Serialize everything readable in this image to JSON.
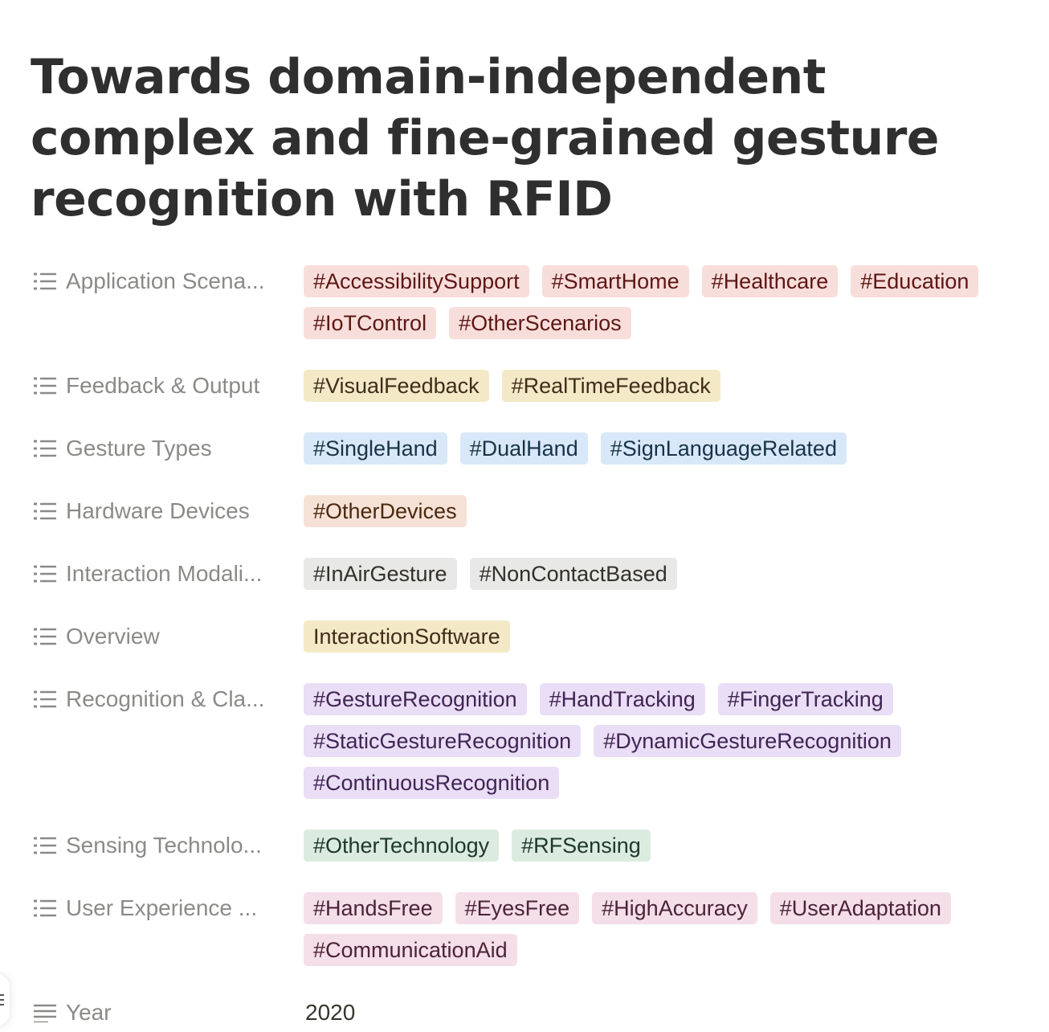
{
  "page": {
    "title": "Towards domain-independent complex and fine-grained gesture recognition with RFID"
  },
  "properties": [
    {
      "label": "Application Scena...",
      "icon": "list-icon",
      "tags": [
        {
          "text": "#AccessibilitySupport",
          "color": "red"
        },
        {
          "text": "#SmartHome",
          "color": "red"
        },
        {
          "text": "#Healthcare",
          "color": "red"
        },
        {
          "text": "#Education",
          "color": "red"
        },
        {
          "text": "#IoTControl",
          "color": "red"
        },
        {
          "text": "#OtherScenarios",
          "color": "red"
        }
      ]
    },
    {
      "label": "Feedback & Output",
      "icon": "list-icon",
      "tags": [
        {
          "text": "#VisualFeedback",
          "color": "yellow"
        },
        {
          "text": "#RealTimeFeedback",
          "color": "yellow"
        }
      ]
    },
    {
      "label": "Gesture Types",
      "icon": "list-icon",
      "tags": [
        {
          "text": "#SingleHand",
          "color": "blue"
        },
        {
          "text": "#DualHand",
          "color": "blue"
        },
        {
          "text": "#SignLanguageRelated",
          "color": "blue"
        }
      ]
    },
    {
      "label": "Hardware Devices",
      "icon": "list-icon",
      "tags": [
        {
          "text": "#OtherDevices",
          "color": "orange"
        }
      ]
    },
    {
      "label": "Interaction Modali...",
      "icon": "list-icon",
      "tags": [
        {
          "text": "#InAirGesture",
          "color": "gray"
        },
        {
          "text": "#NonContactBased",
          "color": "gray"
        }
      ]
    },
    {
      "label": "Overview",
      "icon": "list-icon",
      "tags": [
        {
          "text": "InteractionSoftware",
          "color": "yellow"
        }
      ]
    },
    {
      "label": "Recognition & Cla...",
      "icon": "list-icon",
      "tags": [
        {
          "text": "#GestureRecognition",
          "color": "purple"
        },
        {
          "text": "#HandTracking",
          "color": "purple"
        },
        {
          "text": "#FingerTracking",
          "color": "purple"
        },
        {
          "text": "#StaticGestureRecognition",
          "color": "purple"
        },
        {
          "text": "#DynamicGestureRecognition",
          "color": "purple"
        },
        {
          "text": "#ContinuousRecognition",
          "color": "purple"
        }
      ]
    },
    {
      "label": "Sensing Technolo...",
      "icon": "list-icon",
      "tags": [
        {
          "text": "#OtherTechnology",
          "color": "green"
        },
        {
          "text": "#RFSensing",
          "color": "green"
        }
      ]
    },
    {
      "label": "User Experience ...",
      "icon": "list-icon",
      "tags": [
        {
          "text": "#HandsFree",
          "color": "pink"
        },
        {
          "text": "#EyesFree",
          "color": "pink"
        },
        {
          "text": "#HighAccuracy",
          "color": "pink"
        },
        {
          "text": "#UserAdaptation",
          "color": "pink"
        },
        {
          "text": "#CommunicationAid",
          "color": "pink"
        }
      ]
    },
    {
      "label": "Year",
      "icon": "text-lines-icon",
      "value": "2020"
    }
  ],
  "colors": {
    "red": "#f8dedb",
    "yellow": "#f3e9c6",
    "blue": "#d8e8f8",
    "orange": "#f6e1d6",
    "gray": "#e8e8e6",
    "purple": "#e9def5",
    "green": "#dcebdf",
    "pink": "#f4dfe8"
  }
}
